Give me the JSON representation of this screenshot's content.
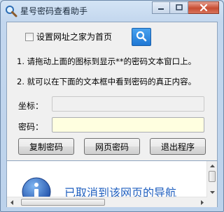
{
  "window": {
    "title": "星号密码查看助手"
  },
  "options": {
    "homepage_checkbox_label": "设置网址之家为首页",
    "homepage_checked": false
  },
  "instructions": {
    "line1": "1. 请拖动上面的图标到显示**的密码文本窗口上。",
    "line2": "2. 就可以在下面的文本框中看到密码的真正内容。"
  },
  "fields": {
    "coord_label": "坐标：",
    "coord_value": "",
    "password_label": "密码：",
    "password_value": ""
  },
  "buttons": {
    "copy": "复制密码",
    "web_password": "网页密码",
    "exit": "退出程序"
  },
  "browser": {
    "message": "已取消到该网页的导航"
  },
  "icons": {
    "app": "magnifier-icon",
    "finder": "search-icon",
    "info": "info-icon"
  },
  "colors": {
    "password_bg": "#ffffe0",
    "info_blue": "#1f5fbf",
    "close_red": "#c74d32"
  }
}
